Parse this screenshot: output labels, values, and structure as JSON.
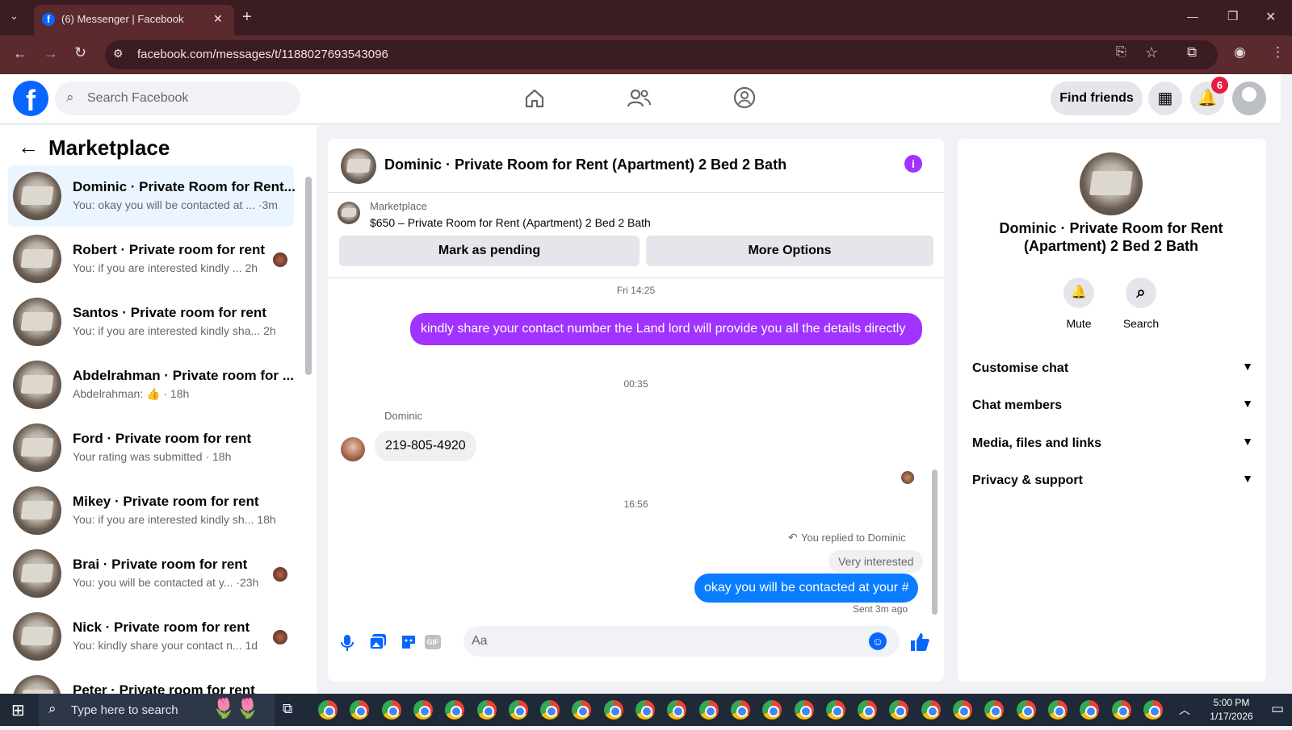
{
  "browser": {
    "tab_title": "(6) Messenger | Facebook",
    "new_tab": "+",
    "url": "facebook.com/messages/t/1188027693543096",
    "controls": {
      "minimize": "—",
      "restore": "❐",
      "close": "✕"
    }
  },
  "header": {
    "search_placeholder": "Search Facebook",
    "find_friends": "Find friends",
    "notification_count": "6"
  },
  "sidebar": {
    "title": "Marketplace",
    "conversations": [
      {
        "title": "Dominic · Private Room for Rent...",
        "snippet": "You: okay you will be contacted at ... ·3m"
      },
      {
        "title": "Robert · Private room for rent",
        "snippet": "You: if you are interested kindly ...  2h"
      },
      {
        "title": "Santos · Private room for rent",
        "snippet": "You: if you are interested kindly sha... 2h"
      },
      {
        "title": "Abdelrahman · Private room for ...",
        "snippet": "Abdelrahman: 👍 · 18h"
      },
      {
        "title": "Ford · Private room for rent",
        "snippet": "Your rating was submitted · 18h"
      },
      {
        "title": "Mikey · Private room for rent",
        "snippet": "You: if you are interested kindly sh... 18h"
      },
      {
        "title": "Brai · Private room for rent",
        "snippet": "You: you will be contacted at y... ·23h"
      },
      {
        "title": "Nick · Private room for rent",
        "snippet": "You: kindly share your contact n...  1d"
      },
      {
        "title": "Peter · Private room for rent",
        "snippet": ""
      }
    ]
  },
  "chat": {
    "title": "Dominic · Private Room for Rent (Apartment) 2 Bed 2 Bath",
    "listing_source": "Marketplace",
    "listing_title": "$650 – Private Room for Rent (Apartment) 2 Bed 2 Bath",
    "mark_pending": "Mark as pending",
    "more_options": "More Options",
    "ts1": "Fri 14:25",
    "msg1": "kindly share your contact number the Land lord will provide you all the details directly",
    "ts2": "00:35",
    "sender_name": "Dominic",
    "msg2": "219-805-4920",
    "ts3": "16:56",
    "reply_note": "You replied to Dominic",
    "quoted": "Very interested",
    "msg3": "okay you will be contacted at your #",
    "sent_status": "Sent 3m ago",
    "input_placeholder": "Aa",
    "gif": "GIF"
  },
  "info": {
    "name": "Dominic · Private Room for Rent (Apartment) 2 Bed 2 Bath",
    "mute": "Mute",
    "search": "Search",
    "sections": [
      "Customise chat",
      "Chat members",
      "Media, files and links",
      "Privacy & support"
    ]
  },
  "taskbar": {
    "search_placeholder": "Type here to search",
    "time": "5:00 PM",
    "date": "1/17/2026"
  },
  "colors": {
    "fb_blue": "#0866ff",
    "purple": "#a033ff",
    "bubble_blue": "#0a7cff"
  }
}
